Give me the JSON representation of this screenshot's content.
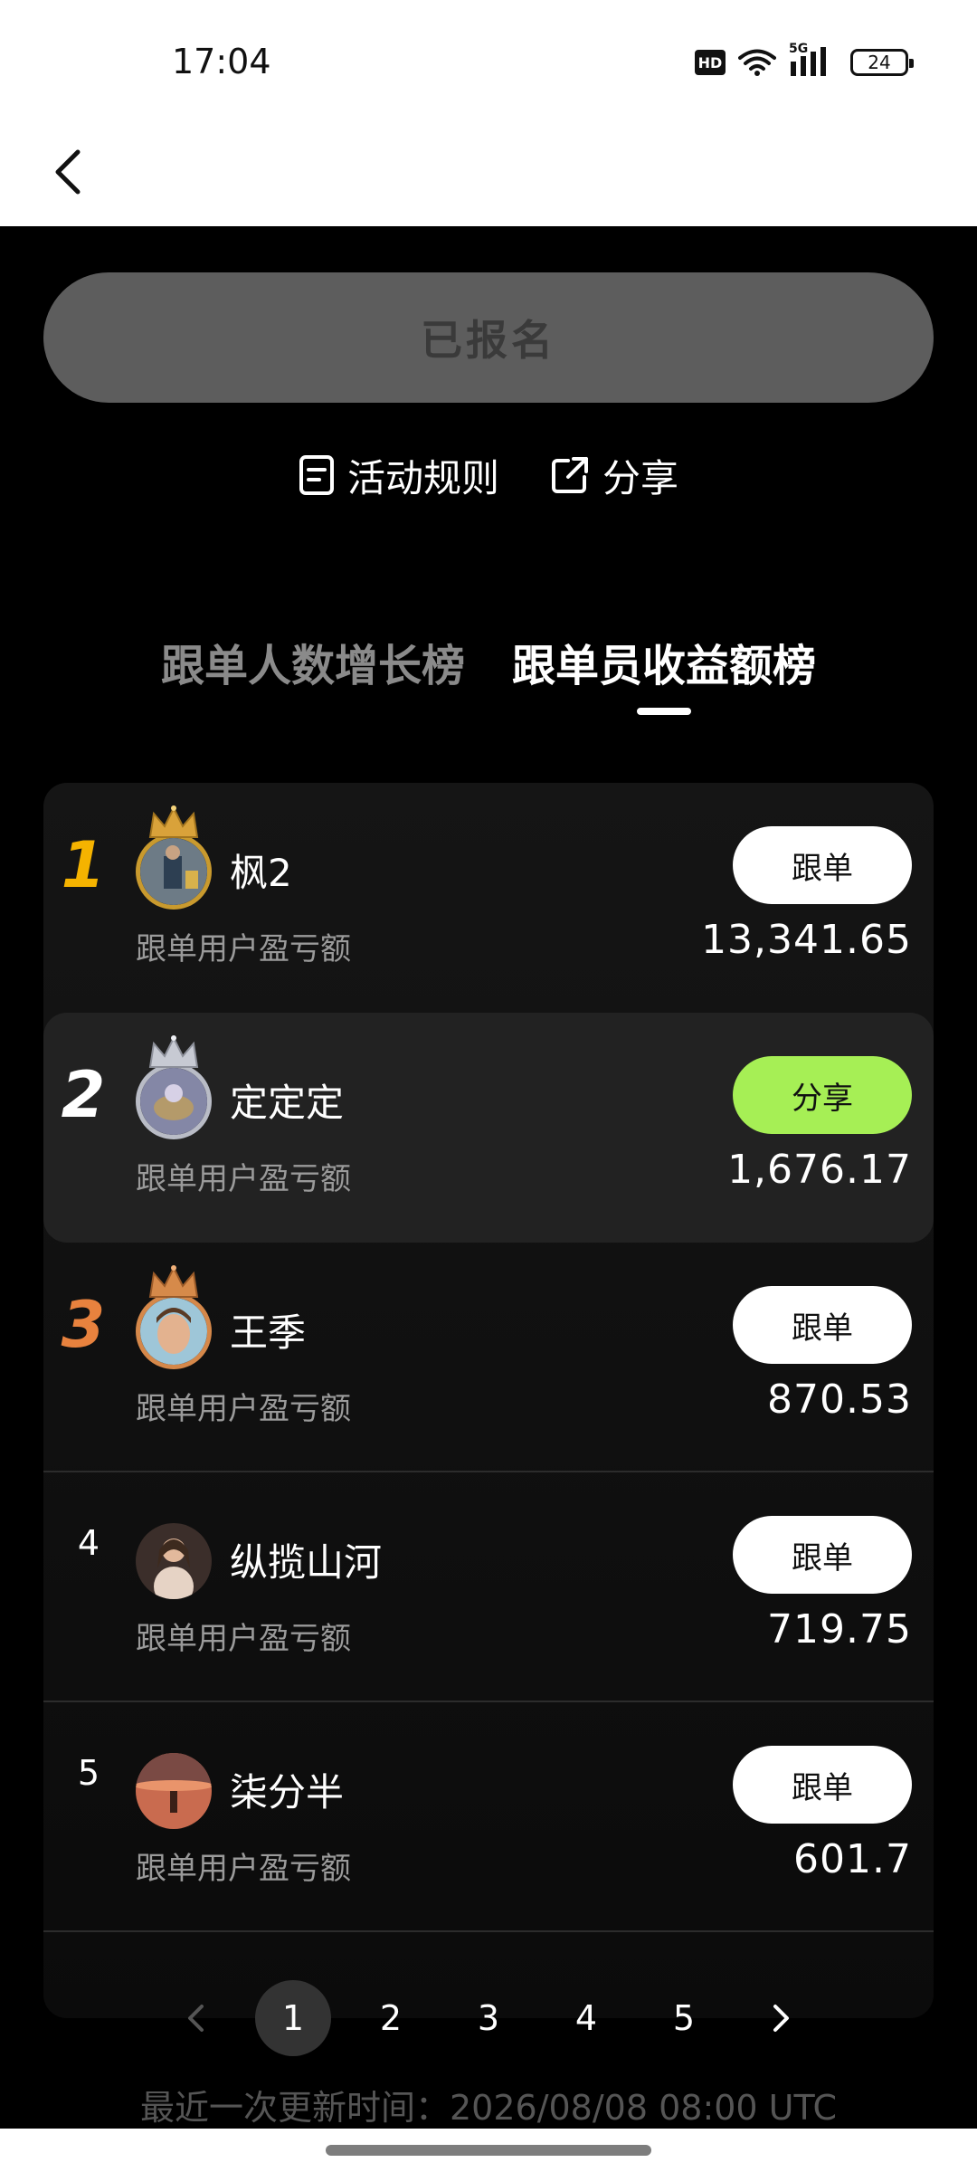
{
  "status_bar": {
    "time": "17:04",
    "hd": "HD",
    "network": "5G",
    "battery": "24",
    "icons": [
      "wifi-icon",
      "signal-icon",
      "battery-icon"
    ]
  },
  "header": {
    "back_icon": "chevron-left-icon"
  },
  "registration": {
    "label": "已报名"
  },
  "links": {
    "rules_label": "活动规则",
    "rules_icon": "document-icon",
    "share_label": "分享",
    "share_icon": "share-external-icon"
  },
  "tabs": [
    {
      "label": "跟单人数增长榜",
      "active": false
    },
    {
      "label": "跟单员收益额榜",
      "active": true
    }
  ],
  "leaderboard": [
    {
      "rank": "1",
      "name": "枫2",
      "subtitle": "跟单用户盈亏额",
      "button": "跟单",
      "amount": "13,341.65",
      "rank_color": "#f5b300"
    },
    {
      "rank": "2",
      "name": "定定定",
      "subtitle": "跟单用户盈亏额",
      "button": "分享",
      "amount": "1,676.17",
      "rank_color": "#ffffff"
    },
    {
      "rank": "3",
      "name": "王季",
      "subtitle": "跟单用户盈亏额",
      "button": "跟单",
      "amount": "870.53",
      "rank_color": "#e8823e"
    },
    {
      "rank": "4",
      "name": "纵揽山河",
      "subtitle": "跟单用户盈亏额",
      "button": "跟单",
      "amount": "719.75"
    },
    {
      "rank": "5",
      "name": "柒分半",
      "subtitle": "跟单用户盈亏额",
      "button": "跟单",
      "amount": "601.7"
    }
  ],
  "pagination": {
    "prev_icon": "chevron-left-icon",
    "next_icon": "chevron-right-icon",
    "pages": [
      "1",
      "2",
      "3",
      "4",
      "5"
    ],
    "current": "1"
  },
  "update_time": "最近一次更新时间：2026/08/08 08:00 UTC",
  "colors": {
    "share_button": "#a6ef55",
    "gold": "#f5b300",
    "bronze": "#e8823e"
  }
}
